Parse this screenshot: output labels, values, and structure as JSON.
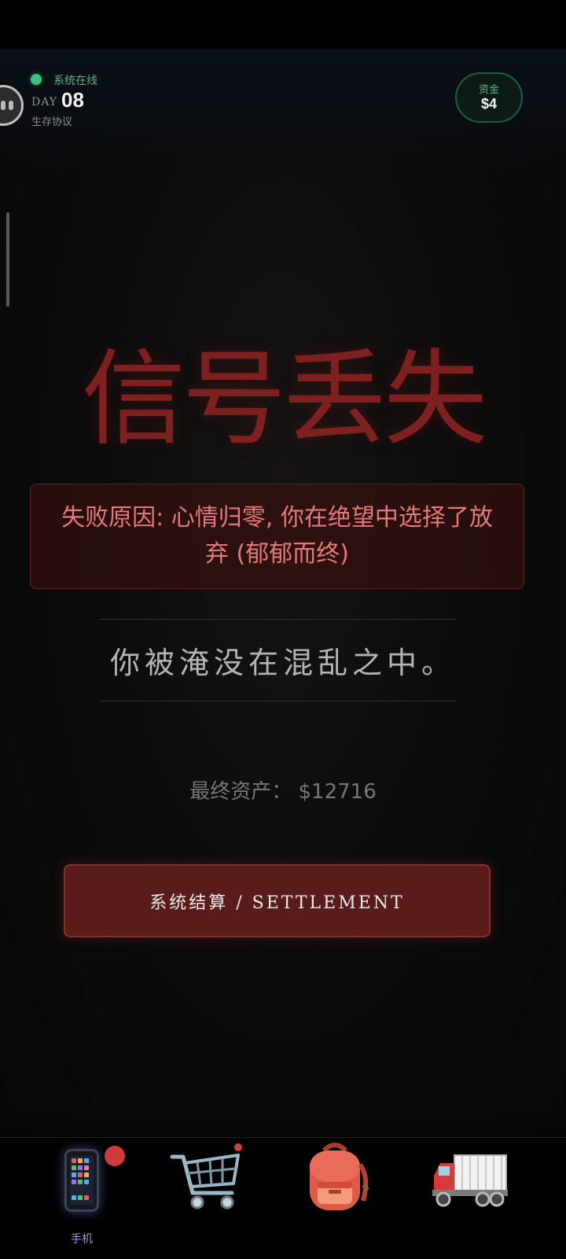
{
  "header": {
    "status_text": "系统在线",
    "day_label": "DAY",
    "day_number": "08",
    "protocol_text": "生存协议",
    "funds_label": "资金",
    "funds_value": "$4"
  },
  "main": {
    "title": "信号丢失",
    "failure_reason": "失败原因: 心情归零, 你在绝望中选择了放弃 (郁郁而终)",
    "narrative": "你被淹没在混乱之中。",
    "final_assets_label": "最终资产：",
    "final_assets_value": "$12716",
    "settlement_button": "系统结算 / SETTLEMENT"
  },
  "bottom_nav": {
    "items": [
      {
        "icon": "phone-icon",
        "label": "手机",
        "active": true,
        "has_badge": true
      },
      {
        "icon": "shopping-cart-icon",
        "label": ""
      },
      {
        "icon": "backpack-icon",
        "label": ""
      },
      {
        "icon": "truck-icon",
        "label": ""
      }
    ]
  },
  "colors": {
    "online_green": "#3fbf7f",
    "title_red": "#7e2020",
    "reason_text": "#e57878",
    "button_bg": "#5a1b1b",
    "badge_red": "#d13a3a"
  }
}
